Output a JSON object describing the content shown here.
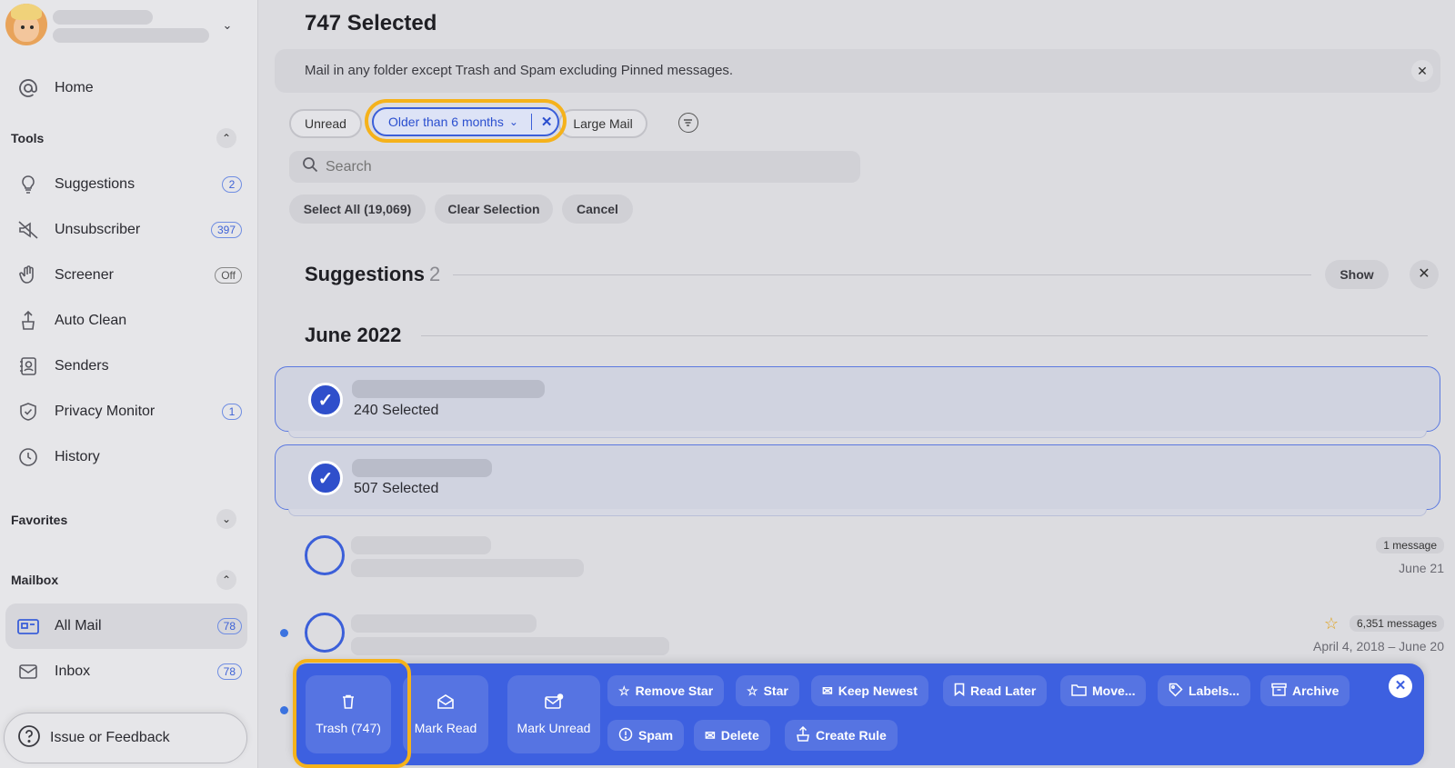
{
  "sidebar": {
    "home_label": "Home",
    "tools_header": "Tools",
    "tools": [
      {
        "label": "Suggestions",
        "badge": "2"
      },
      {
        "label": "Unsubscriber",
        "badge": "397"
      },
      {
        "label": "Screener",
        "badge": "Off"
      },
      {
        "label": "Auto Clean",
        "badge": ""
      },
      {
        "label": "Senders",
        "badge": ""
      },
      {
        "label": "Privacy Monitor",
        "badge": "1"
      },
      {
        "label": "History",
        "badge": ""
      }
    ],
    "favorites_header": "Favorites",
    "mailbox_header": "Mailbox",
    "mailbox": [
      {
        "label": "All Mail",
        "badge": "78"
      },
      {
        "label": "Inbox",
        "badge": "78"
      }
    ],
    "feedback_label": "Issue or Feedback"
  },
  "main": {
    "title": "747 Selected",
    "info_text": "Mail in any folder except Trash and Spam excluding Pinned messages.",
    "filters": {
      "unread": "Unread",
      "older": "Older than 6 months",
      "large": "Large Mail"
    },
    "search_placeholder": "Search",
    "buttons": {
      "select_all": "Select All (19,069)",
      "clear_selection": "Clear Selection",
      "cancel": "Cancel"
    },
    "suggestions": {
      "title": "Suggestions",
      "count": "2",
      "show": "Show"
    },
    "month": "June 2022",
    "groups": [
      {
        "count_text": "240 Selected"
      },
      {
        "count_text": "507 Selected"
      }
    ],
    "rows": [
      {
        "messages": "1 message",
        "date": "June 21",
        "starred": false
      },
      {
        "messages": "6,351 messages",
        "date": "April 4, 2018 – June 20",
        "starred": true
      }
    ]
  },
  "action_bar": {
    "trash": "Trash (747)",
    "mark_read": "Mark Read",
    "mark_unread": "Mark Unread",
    "remove_star": "Remove Star",
    "star": "Star",
    "keep_newest": "Keep Newest",
    "read_later": "Read Later",
    "move": "Move...",
    "labels": "Labels...",
    "archive": "Archive",
    "spam": "Spam",
    "delete": "Delete",
    "create_rule": "Create Rule"
  },
  "colors": {
    "accent": "#3d60e0",
    "highlight": "#f5b21b"
  }
}
